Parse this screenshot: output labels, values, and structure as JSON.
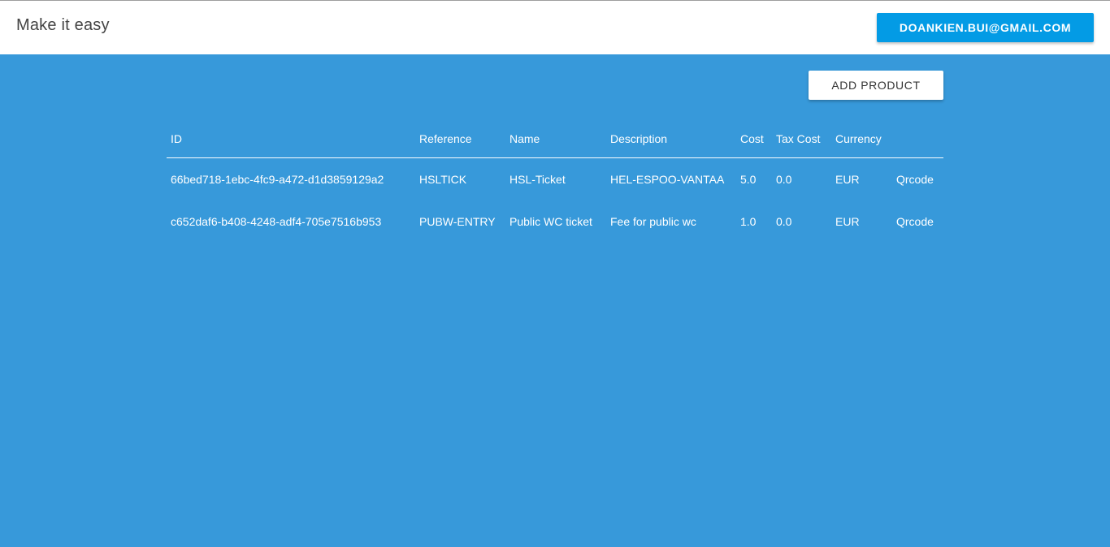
{
  "header": {
    "brand": "Make it easy",
    "user_email": "DOANKIEN.BUI@GMAIL.COM"
  },
  "toolbar": {
    "add_product_label": "ADD PRODUCT"
  },
  "table": {
    "columns": [
      "ID",
      "Reference",
      "Name",
      "Description",
      "Cost",
      "Tax Cost",
      "Currency",
      ""
    ],
    "rows": [
      {
        "id": "66bed718-1ebc-4fc9-a472-d1d3859129a2",
        "reference": "HSLTICK",
        "name": "HSL-Ticket",
        "description": "HEL-ESPOO-VANTAA",
        "cost": "5.0",
        "tax_cost": "0.0",
        "currency": "EUR",
        "action": "Qrcode"
      },
      {
        "id": "c652daf6-b408-4248-adf4-705e7516b953",
        "reference": "PUBW-ENTRY",
        "name": "Public WC ticket",
        "description": "Fee for public wc",
        "cost": "1.0",
        "tax_cost": "0.0",
        "currency": "EUR",
        "action": "Qrcode"
      }
    ]
  },
  "colors": {
    "background": "#3799da",
    "header_bg": "#ffffff",
    "user_button": "#039be5"
  }
}
